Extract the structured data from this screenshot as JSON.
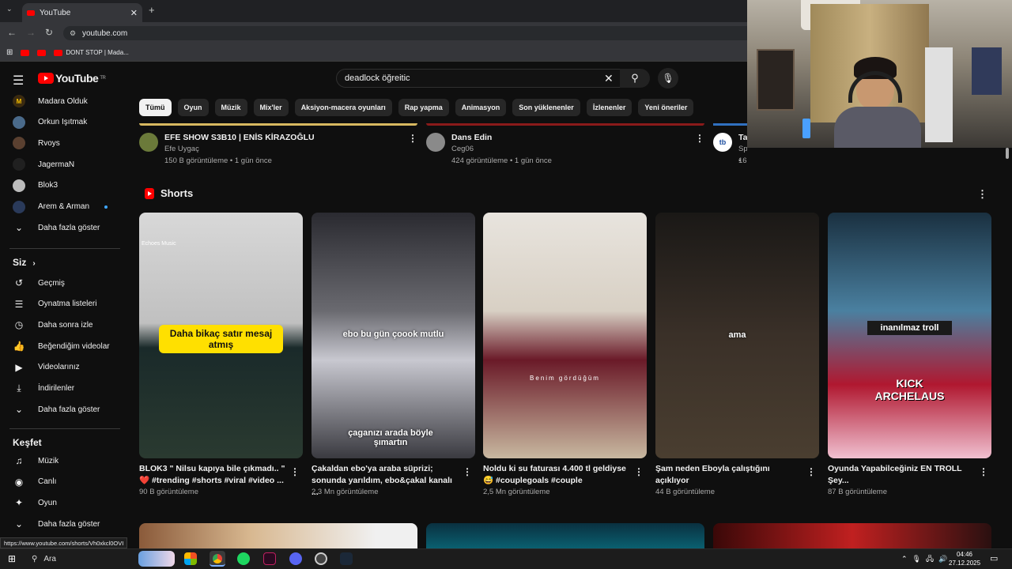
{
  "browser": {
    "tab_title": "YouTube",
    "tab_close": "✕",
    "new_tab": "+",
    "url": "youtube.com",
    "bookmark_label": "DONT STOP | Mada...",
    "status_url": "https://www.youtube.com/shorts/Vh0xkcl0OVI"
  },
  "header": {
    "logo_text": "YouTube",
    "region": "TR",
    "search_value": "deadlock öğreitic"
  },
  "chips": [
    "Tümü",
    "Oyun",
    "Müzik",
    "Mix'ler",
    "Aksiyon-macera oyunları",
    "Rap yapma",
    "Animasyon",
    "Son yüklenenler",
    "İzlenenler",
    "Yeni öneriler"
  ],
  "sidebar": {
    "subscriptions": [
      {
        "label": "Madara Olduk",
        "color": "#3b2b10",
        "icon": "M"
      },
      {
        "label": "Orkun Işıtmak",
        "color": "#4a6a8a",
        "icon": ""
      },
      {
        "label": "Rvoys",
        "color": "#5a4030",
        "icon": ""
      },
      {
        "label": "JagermaN",
        "color": "#202020",
        "icon": ""
      },
      {
        "label": "Blok3",
        "color": "#bcbcbc",
        "icon": ""
      },
      {
        "label": "Arem & Arman",
        "color": "#2a3a5a",
        "icon": ""
      }
    ],
    "more_subs": "Daha fazla göster",
    "you_heading": "Siz",
    "you_items": [
      {
        "label": "Geçmiş",
        "icon": "history-icon",
        "glyph": "↺"
      },
      {
        "label": "Oynatma listeleri",
        "icon": "playlist-icon",
        "glyph": "☰"
      },
      {
        "label": "Daha sonra izle",
        "icon": "clock-icon",
        "glyph": "◷"
      },
      {
        "label": "Beğendiğim videolar",
        "icon": "thumbs-up-icon",
        "glyph": "👍"
      },
      {
        "label": "Videolarınız",
        "icon": "video-icon",
        "glyph": "▶"
      },
      {
        "label": "İndirilenler",
        "icon": "download-icon",
        "glyph": "⤓"
      }
    ],
    "more_you": "Daha fazla göster",
    "explore_heading": "Keşfet",
    "explore_items": [
      {
        "label": "Müzik",
        "icon": "music-icon",
        "glyph": "♫"
      },
      {
        "label": "Canlı",
        "icon": "live-icon",
        "glyph": "◉"
      },
      {
        "label": "Oyun",
        "icon": "gaming-icon",
        "glyph": "✦"
      }
    ],
    "more_explore": "Daha fazla göster"
  },
  "videos": [
    {
      "title": "EFE SHOW S3B10 | ENİS KİRAZOĞLU",
      "channel": "Efe Uygaç",
      "meta": "150 B görüntüleme • 1 gün önce",
      "avatar_color": "#6b7a3a"
    },
    {
      "title": "Dans Edin",
      "channel": "Ceg06",
      "meta": "424 görüntüleme • 1 gün önce",
      "avatar_color": "#8a8a8a"
    },
    {
      "title": "Ta",
      "channel": "Sponsorlu • TatilBudur",
      "meta": "16 Mn görüntüleme • 2 hafta önce",
      "avatar_color": "#ffffff",
      "avatar_text": "tb"
    }
  ],
  "shorts": {
    "heading": "Shorts",
    "items": [
      {
        "title": "BLOK3 \" Nilsu kapıya bile çıkmadı.. \" ❤️ #trending #shorts #viral #video ...",
        "views": "90 B görüntüleme",
        "caption": "Daha bikaç satır mesaj atmış",
        "watermark": "Echoes Music"
      },
      {
        "title": "Çakaldan ebo'ya araba süprizi; sonunda yarıldım, ebo&çakal kanalı ...",
        "views": "2,3 Mn görüntüleme",
        "caption": "ebo bu gün çoook mutlu",
        "caption2": "çaganızı arada böyle şımartın"
      },
      {
        "title": "Noldu ki su faturası 4.400 tl geldiyse 😅 #couplegoals #couple",
        "views": "2,5 Mn görüntüleme",
        "caption": "Benim gördüğüm"
      },
      {
        "title": "Şam neden Eboyla çalıştığını açıklıyor",
        "views": "44 B görüntüleme",
        "caption": "ama"
      },
      {
        "title": "Oyunda Yapabilceğiniz EN TROLL Şey...",
        "views": "87 B görüntüleme",
        "caption": "inanılmaz troll",
        "caption2": "KICK ARCHELAUS"
      }
    ]
  },
  "taskbar": {
    "search_label": "Ara",
    "time": "04:46",
    "date": "27.12.2025"
  },
  "colors": {
    "brand": "#ff0000",
    "background": "#0f0f0f",
    "chip": "#272727"
  }
}
